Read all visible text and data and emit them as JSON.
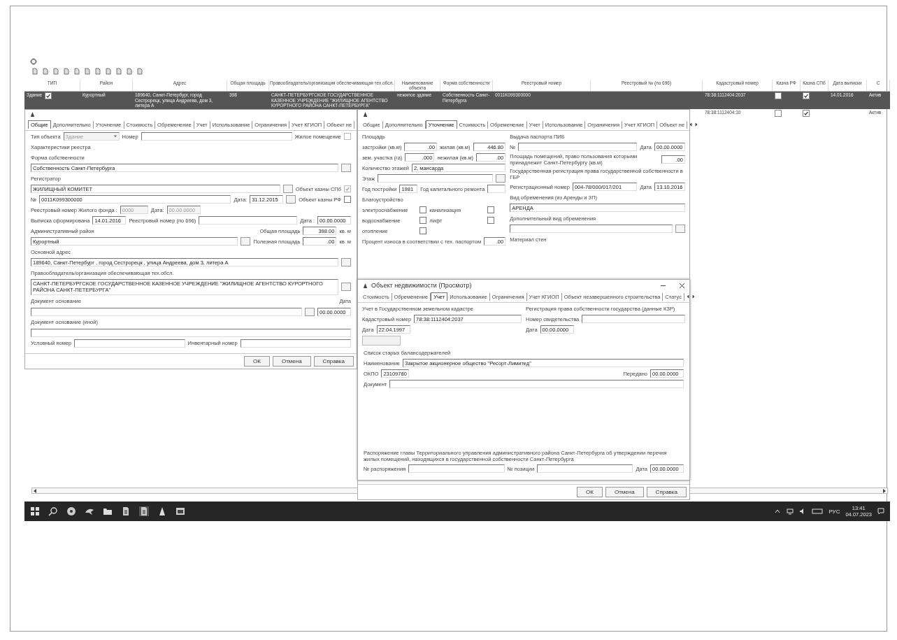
{
  "table": {
    "columns": [
      "ТИП",
      "Район",
      "Адрес",
      "Общая площадь",
      "Правообладатель/организация обеспечивающая тех.обсл.",
      "Наименование объекта",
      "Форма собственности",
      "Реестровый номер",
      "Реестровый № (по 696)",
      "Кадастровый номер",
      "Казна РФ",
      "Казна СПб",
      "Дата выписки",
      "С"
    ],
    "rows": [
      {
        "selected": true,
        "cells": [
          {
            "text": "Здание",
            "checked": true
          },
          {
            "text": "Курортный"
          },
          {
            "text": "189640, Санкт-Петербург, город Сестрорецк, улица Андреева, дом 3, литера А"
          },
          {
            "text": "398"
          },
          {
            "text": "САНКТ-ПЕТЕРБУРГСКОЕ ГОСУДАРСТВЕННОЕ КАЗЕННОЕ УЧРЕЖДЕНИЕ \"ЖИЛИЩНОЕ АГЕНТСТВО КУРОРТНОГО РАЙОНА САНКТ-ПЕТЕРБУРГА\""
          },
          {
            "text": "нежилое здание"
          },
          {
            "text": "Собственность Санкт-Петербурга"
          },
          {
            "text": "0011K099300000"
          },
          {},
          {
            "text": "78:38:1112404:2037"
          },
          {
            "checked": false
          },
          {
            "checked": true
          },
          {
            "text": "14.01.2016"
          },
          {
            "text": "Актив"
          }
        ]
      },
      {
        "selected": false,
        "cells": [
          {},
          {},
          {},
          {},
          {},
          {},
          {},
          {},
          {},
          {
            "text": "78:38:1112404:10"
          },
          {
            "checked": false
          },
          {
            "checked": true
          },
          {},
          {
            "text": "Актив"
          }
        ]
      }
    ]
  },
  "left_window": {
    "tabs": [
      {
        "label": "Общие",
        "selected": true
      },
      {
        "label": "Дополнительно",
        "selected": false
      },
      {
        "label": "Уточнение",
        "selected": false
      },
      {
        "label": "Стоимость",
        "selected": false
      },
      {
        "label": "Обременение",
        "selected": false
      },
      {
        "label": "Учет",
        "selected": false
      },
      {
        "label": "Использование",
        "selected": false
      },
      {
        "label": "Ограничения",
        "selected": false
      },
      {
        "label": "Учет КГИОП",
        "selected": false
      },
      {
        "label": "Объект не",
        "selected": false
      }
    ],
    "rows": [
      {
        "items": [
          {
            "kind": "label",
            "text": "Тип объекта"
          },
          {
            "kind": "select",
            "value": "Здание",
            "disabled": true
          },
          {
            "kind": "label",
            "text": "Номер"
          },
          {
            "kind": "field"
          }
        ],
        "end": [
          {
            "kind": "checkbox",
            "label": "Жилое помещение",
            "checked": false,
            "disabled": true
          }
        ]
      },
      {
        "items": [
          {
            "kind": "caption",
            "text": "Характеристики реестра"
          }
        ]
      },
      {
        "items": [
          {
            "kind": "caption",
            "text": "Форма собственности"
          }
        ]
      },
      {
        "items": [
          {
            "kind": "field",
            "value": "Собственность Санкт-Петербурга"
          },
          {
            "kind": "browse"
          }
        ]
      },
      {
        "items": [
          {
            "kind": "caption",
            "text": "Регистратор"
          }
        ]
      },
      {
        "items": [
          {
            "kind": "field",
            "value": "ЖИЛИЩНЫЙ КОМИТЕТ"
          },
          {
            "kind": "browse"
          }
        ],
        "end": [
          {
            "kind": "checkbox",
            "label": "Объект казны СПб",
            "checked": true,
            "disabled": true
          }
        ]
      },
      {
        "items": [
          {
            "kind": "label",
            "text": "№"
          },
          {
            "kind": "field",
            "value": "0011K099300000"
          },
          {
            "kind": "label",
            "text": "Дата:"
          },
          {
            "kind": "date",
            "value": "31.12.2015"
          },
          {
            "kind": "browse"
          }
        ],
        "end": [
          {
            "kind": "checkbox",
            "label": "Объект казны РФ",
            "checked": false,
            "disabled": false
          }
        ]
      },
      {
        "items": [
          {
            "kind": "label",
            "text": "Реестровый номер Жилого фонда :"
          },
          {
            "kind": "short",
            "value": "0000",
            "disabled": true
          },
          {
            "kind": "label",
            "text": "Дата:"
          },
          {
            "kind": "date",
            "value": "00.00.0000",
            "disabled": true
          }
        ]
      },
      {
        "items": [
          {
            "kind": "label",
            "text": "Выписка сформирована"
          },
          {
            "kind": "date",
            "value": "14.01.2016"
          },
          {
            "kind": "label",
            "text": "Реестровый номер (по 696)"
          },
          {
            "kind": "field"
          },
          {
            "kind": "label",
            "text": "Дата :"
          },
          {
            "kind": "date",
            "value": "00.00.0000"
          }
        ]
      },
      {
        "items": [
          {
            "kind": "caption",
            "text": "Административный район"
          }
        ],
        "end": [
          {
            "kind": "label",
            "text": "Общая площадь"
          },
          {
            "kind": "number",
            "value": "398.00"
          },
          {
            "kind": "label",
            "text": "кв. м"
          }
        ]
      },
      {
        "items": [
          {
            "kind": "field",
            "value": "Курортный"
          },
          {
            "kind": "browse"
          }
        ],
        "end": [
          {
            "kind": "label",
            "text": "Полезная площадь"
          },
          {
            "kind": "number",
            "value": ".00"
          },
          {
            "kind": "label",
            "text": "кв. м"
          }
        ]
      },
      {
        "items": [
          {
            "kind": "caption",
            "text": "Основной адрес"
          }
        ]
      },
      {
        "items": [
          {
            "kind": "field",
            "value": "189640, Санкт-Петербург , город Сестрорецк , улица Андреева, дом 3, литера А"
          },
          {
            "kind": "browse"
          }
        ]
      },
      {
        "items": [
          {
            "kind": "caption",
            "text": "Правообладатель/организация обеспечивающая тех.обсл."
          }
        ]
      },
      {
        "items": [
          {
            "kind": "area",
            "value": "САНКТ-ПЕТЕРБУРГСКОЕ ГОСУДАРСТВЕННОЕ КАЗЕННОЕ УЧРЕЖДЕНИЕ \"ЖИЛИЩНОЕ АГЕНТСТВО КУРОРТНОГО РАЙОНА САНКТ-ПЕТЕРБУРГА\""
          },
          {
            "kind": "browse"
          }
        ]
      },
      {
        "items": [
          {
            "kind": "caption",
            "text": "Документ основание"
          }
        ],
        "end": [
          {
            "kind": "label",
            "text": "Дата"
          }
        ]
      },
      {
        "items": [
          {
            "kind": "field"
          },
          {
            "kind": "browse"
          },
          {
            "kind": "date",
            "value": "00.00.0000"
          }
        ]
      },
      {
        "items": [
          {
            "kind": "caption",
            "text": "Документ основание (иной)"
          }
        ]
      },
      {
        "items": [
          {
            "kind": "field"
          }
        ]
      },
      {
        "items": [
          {
            "kind": "label",
            "text": "Условный номер"
          },
          {
            "kind": "field"
          },
          {
            "kind": "label",
            "text": "Инвентарный номер"
          },
          {
            "kind": "field"
          }
        ]
      }
    ],
    "buttons": [
      "ОК",
      "Отмена",
      "Справка"
    ]
  },
  "middle_window": {
    "tabs": [
      {
        "label": "Общие",
        "selected": false
      },
      {
        "label": "Дополнительно",
        "selected": false
      },
      {
        "label": "Уточнение",
        "selected": true
      },
      {
        "label": "Стоимость",
        "selected": false
      },
      {
        "label": "Обременение",
        "selected": false
      },
      {
        "label": "Учет",
        "selected": false
      },
      {
        "label": "Использование",
        "selected": false
      },
      {
        "label": "Ограничения",
        "selected": false
      },
      {
        "label": "Учет КГИОП",
        "selected": false
      },
      {
        "label": "Объект не",
        "selected": false
      }
    ],
    "left": [
      {
        "items": [
          {
            "kind": "caption",
            "text": "Площадь"
          }
        ]
      },
      {
        "items": [
          {
            "kind": "label",
            "text": "застройки (кв.м)"
          },
          {
            "kind": "number",
            "value": ".00"
          },
          {
            "kind": "label",
            "text": "жилая (кв.м)"
          },
          {
            "kind": "number",
            "value": "446.80"
          }
        ]
      },
      {
        "items": [
          {
            "kind": "label",
            "text": "зем. участка (га)"
          },
          {
            "kind": "number",
            "value": ".000"
          },
          {
            "kind": "label",
            "text": "нежилая (кв.м)"
          },
          {
            "kind": "number",
            "value": ".00"
          }
        ]
      },
      {
        "items": [
          {
            "kind": "label",
            "text": "Количество этажей"
          },
          {
            "kind": "field",
            "value": "2, мансарда"
          }
        ]
      },
      {
        "items": [
          {
            "kind": "label",
            "text": "Этаж"
          },
          {
            "kind": "field"
          },
          {
            "kind": "browse"
          }
        ]
      },
      {
        "items": [
          {
            "kind": "label",
            "text": "Год постройки"
          },
          {
            "kind": "short",
            "value": "1981"
          },
          {
            "kind": "label",
            "text": "Год капитального ремонта"
          },
          {
            "kind": "short"
          }
        ]
      },
      {
        "items": [
          {
            "kind": "caption",
            "text": "Благоустройство"
          }
        ]
      },
      {
        "items": [
          {
            "kind": "checkbox",
            "label": "электроснабжение",
            "checked": false,
            "disabled": false
          },
          {
            "kind": "checkbox",
            "label": "канализация",
            "checked": false,
            "disabled": false
          }
        ]
      },
      {
        "items": [
          {
            "kind": "checkbox",
            "label": "водоснабжение",
            "checked": false,
            "disabled": false
          },
          {
            "kind": "checkbox",
            "label": "лифт",
            "checked": false,
            "disabled": false
          }
        ]
      },
      {
        "items": [
          {
            "kind": "checkbox",
            "label": "отопление",
            "checked": false,
            "disabled": false
          }
        ]
      },
      {
        "items": [
          {
            "kind": "label",
            "text": "Процент износа в соответствии с тех. паспортом"
          },
          {
            "kind": "number",
            "value": ".00"
          }
        ]
      }
    ],
    "right": [
      {
        "items": [
          {
            "kind": "caption",
            "text": "Выдача паспорта ПИБ"
          }
        ]
      },
      {
        "items": [
          {
            "kind": "label",
            "text": "№"
          },
          {
            "kind": "field"
          },
          {
            "kind": "label",
            "text": "Дата"
          },
          {
            "kind": "date",
            "value": "00.00.0000"
          }
        ]
      },
      {
        "items": [
          {
            "kind": "label",
            "text": "Площадь помещений, право пользования которыми принадлежит Санкт-Петербургу (кв.м)"
          },
          {
            "kind": "number",
            "value": ".00"
          }
        ]
      },
      {
        "items": [
          {
            "kind": "caption",
            "text": "Государственная регистрация права государственной собственности в ГБР"
          }
        ]
      },
      {
        "items": [
          {
            "kind": "label",
            "text": "Регистрационный номер"
          },
          {
            "kind": "field",
            "value": "004-78/000/017/201"
          },
          {
            "kind": "label",
            "text": "Дата"
          },
          {
            "kind": "date",
            "value": "13.10.2016"
          }
        ]
      },
      {
        "items": [
          {
            "kind": "caption",
            "text": "Вид обременения (из Аренды и ЗП)"
          }
        ]
      },
      {
        "items": [
          {
            "kind": "field",
            "value": "АРЕНДА"
          }
        ]
      },
      {
        "items": [
          {
            "kind": "caption",
            "text": "Дополнительный вид обременения"
          }
        ]
      },
      {
        "items": [
          {
            "kind": "field"
          },
          {
            "kind": "browse"
          }
        ]
      },
      {
        "items": [
          {
            "kind": "caption",
            "text": "Материал стен"
          }
        ]
      }
    ],
    "buttons": [
      "ОК",
      "Отмена",
      "Справка"
    ]
  },
  "dialog": {
    "title": "Объект недвижимости (Просмотр)",
    "tabs": [
      {
        "label": "Стоимость",
        "selected": false
      },
      {
        "label": "Обременение",
        "selected": false
      },
      {
        "label": "Учет",
        "selected": true
      },
      {
        "label": "Использование",
        "selected": false
      },
      {
        "label": "Ограничения",
        "selected": false
      },
      {
        "label": "Учет КГИОП",
        "selected": false
      },
      {
        "label": "Объект незавершенного строительства",
        "selected": false
      },
      {
        "label": "Статус",
        "selected": false
      }
    ],
    "left": [
      {
        "items": [
          {
            "kind": "caption",
            "text": "Учет в Государственном земельном кадастре"
          }
        ]
      },
      {
        "items": [
          {
            "kind": "label",
            "text": "Кадастровый номер"
          },
          {
            "kind": "field",
            "value": "78:38:1112404:2037"
          }
        ]
      },
      {
        "items": [
          {
            "kind": "label",
            "text": "Дата"
          },
          {
            "kind": "date",
            "value": "22.04.1997"
          }
        ]
      },
      {
        "items": [
          {
            "kind": "button",
            "disabled": true
          }
        ]
      }
    ],
    "right": [
      {
        "items": [
          {
            "kind": "caption",
            "text": "Регистрация права собственности государства (данные КЗР)"
          }
        ]
      },
      {
        "items": [
          {
            "kind": "label",
            "text": "Номер свидетельства"
          },
          {
            "kind": "field"
          }
        ]
      },
      {
        "items": [
          {
            "kind": "label",
            "text": "Дата"
          },
          {
            "kind": "date",
            "value": "00.00.0000"
          }
        ]
      }
    ],
    "rows": [
      {
        "items": [
          {
            "kind": "caption",
            "text": "Список старых балансодержателей"
          }
        ]
      },
      {
        "items": [
          {
            "kind": "label",
            "text": "Наименование"
          },
          {
            "kind": "field",
            "value": "Закрытое акционерное общество \"Ресорт-Лимитед\""
          }
        ]
      },
      {
        "items": [
          {
            "kind": "label",
            "text": "ОКПО"
          },
          {
            "kind": "short",
            "value": "23109780"
          }
        ],
        "end": [
          {
            "kind": "label",
            "text": "Передано"
          },
          {
            "kind": "date",
            "value": "00.00.0000"
          }
        ]
      },
      {
        "items": [
          {
            "kind": "label",
            "text": "Документ"
          },
          {
            "kind": "field"
          }
        ]
      }
    ],
    "order_rows": [
      {
        "items": [
          {
            "kind": "caption",
            "text": "Распоряжение главы Территориального управления административного района Санкт-Петербурга об утверждении перечня жилых помещений, находящихся в государственной собственности Санкт-Петербурга"
          }
        ]
      },
      {
        "items": [
          {
            "kind": "label",
            "text": "№ распоряжения"
          },
          {
            "kind": "field"
          },
          {
            "kind": "label",
            "text": "№ позиции"
          },
          {
            "kind": "field"
          },
          {
            "kind": "label",
            "text": "Дата"
          },
          {
            "kind": "date",
            "value": "00.00.0000"
          }
        ]
      }
    ]
  },
  "taskbar": {
    "language": "РУС",
    "time": "13:41",
    "date": "04.07.2023"
  }
}
